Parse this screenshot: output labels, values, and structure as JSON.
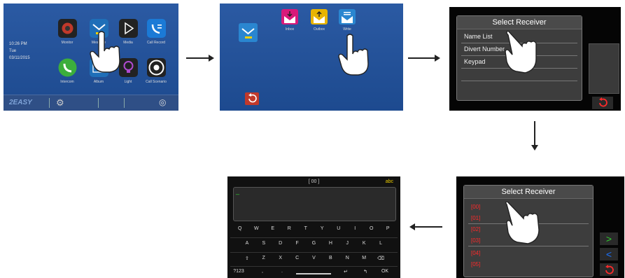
{
  "step1": {
    "clock_time": "10:26 PM",
    "clock_day": "Tue",
    "clock_date": "03/11/2015",
    "tiles": [
      {
        "label": "Monitor",
        "icon": "camera-icon"
      },
      {
        "label": "Message",
        "icon": "envelope-icon"
      },
      {
        "label": "Media",
        "icon": "play-icon"
      },
      {
        "label": "Call Record",
        "icon": "phone-list-icon"
      },
      {
        "label": "Intercom",
        "icon": "phone-icon"
      },
      {
        "label": "Album",
        "icon": "photo-icon"
      },
      {
        "label": "Light",
        "icon": "bulb-icon"
      },
      {
        "label": "Call Scenario",
        "icon": "call-scenario-icon"
      }
    ],
    "brand": "2EASY"
  },
  "step2": {
    "items": [
      {
        "label": "Inbox",
        "color": "#d91a7a"
      },
      {
        "label": "Outbox",
        "color": "#e8b400"
      },
      {
        "label": "Write",
        "color": "#2a86d0"
      }
    ]
  },
  "step3": {
    "title": "Select Receiver",
    "options": [
      "Name List",
      "Divert Number",
      "Keypad"
    ]
  },
  "step4": {
    "title": "Select Receiver",
    "entries": [
      "[00]",
      "[01]",
      "[02]",
      "[03]",
      "[04]",
      "[05]"
    ]
  },
  "step5": {
    "header": "[ 00 ]",
    "mode": "abc",
    "cursor": "_",
    "rows": [
      [
        "Q",
        "W",
        "E",
        "R",
        "T",
        "Y",
        "U",
        "I",
        "O",
        "P"
      ],
      [
        "A",
        "S",
        "D",
        "F",
        "G",
        "H",
        "J",
        "K",
        "L"
      ],
      [
        "⇧",
        "Z",
        "X",
        "C",
        "V",
        "B",
        "N",
        "M",
        "⌫"
      ]
    ],
    "bottom": [
      "?123",
      ",",
      ".",
      "",
      "↵",
      "↰",
      "OK"
    ]
  },
  "colors": {
    "accent_green": "#2fd12f",
    "accent_blue": "#1a73ff",
    "red": "#ff2a2a",
    "yellow": "#f0d000"
  }
}
